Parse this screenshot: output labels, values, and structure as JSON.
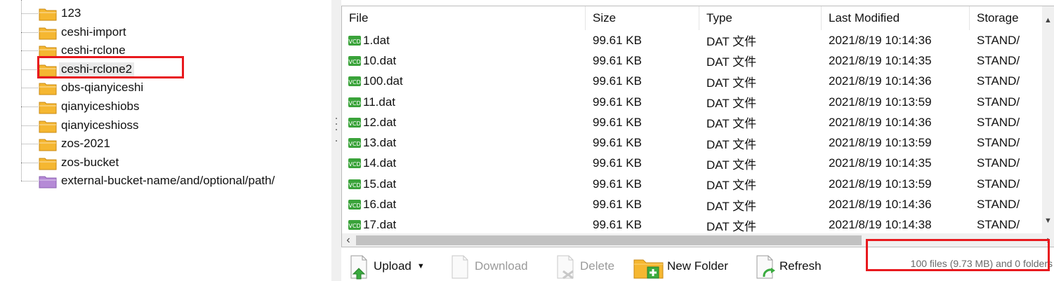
{
  "tree": {
    "items": [
      {
        "label": "123",
        "kind": "folder"
      },
      {
        "label": "ceshi-import",
        "kind": "folder"
      },
      {
        "label": "ceshi-rclone",
        "kind": "folder"
      },
      {
        "label": "ceshi-rclone2",
        "kind": "folder",
        "selected": true
      },
      {
        "label": "obs-qianyiceshi",
        "kind": "folder"
      },
      {
        "label": "qianyiceshiobs",
        "kind": "folder"
      },
      {
        "label": "qianyiceshioss",
        "kind": "folder"
      },
      {
        "label": "zos-2021",
        "kind": "folder"
      },
      {
        "label": "zos-bucket",
        "kind": "folder"
      },
      {
        "label": "external-bucket-name/and/optional/path/",
        "kind": "external"
      }
    ]
  },
  "list": {
    "columns": [
      "File",
      "Size",
      "Type",
      "Last Modified",
      "Storage"
    ],
    "rows": [
      {
        "file": "1.dat",
        "size": "99.61 KB",
        "type": "DAT 文件",
        "modified": "2021/8/19 10:14:36",
        "storage": "STAND/"
      },
      {
        "file": "10.dat",
        "size": "99.61 KB",
        "type": "DAT 文件",
        "modified": "2021/8/19 10:14:35",
        "storage": "STAND/"
      },
      {
        "file": "100.dat",
        "size": "99.61 KB",
        "type": "DAT 文件",
        "modified": "2021/8/19 10:14:36",
        "storage": "STAND/"
      },
      {
        "file": "11.dat",
        "size": "99.61 KB",
        "type": "DAT 文件",
        "modified": "2021/8/19 10:13:59",
        "storage": "STAND/"
      },
      {
        "file": "12.dat",
        "size": "99.61 KB",
        "type": "DAT 文件",
        "modified": "2021/8/19 10:14:36",
        "storage": "STAND/"
      },
      {
        "file": "13.dat",
        "size": "99.61 KB",
        "type": "DAT 文件",
        "modified": "2021/8/19 10:13:59",
        "storage": "STAND/"
      },
      {
        "file": "14.dat",
        "size": "99.61 KB",
        "type": "DAT 文件",
        "modified": "2021/8/19 10:14:35",
        "storage": "STAND/"
      },
      {
        "file": "15.dat",
        "size": "99.61 KB",
        "type": "DAT 文件",
        "modified": "2021/8/19 10:13:59",
        "storage": "STAND/"
      },
      {
        "file": "16.dat",
        "size": "99.61 KB",
        "type": "DAT 文件",
        "modified": "2021/8/19 10:14:36",
        "storage": "STAND/"
      },
      {
        "file": "17.dat",
        "size": "99.61 KB",
        "type": "DAT 文件",
        "modified": "2021/8/19 10:14:38",
        "storage": "STAND/"
      }
    ],
    "file_icon": "vcd-file-icon"
  },
  "toolbar": {
    "upload": "Upload",
    "download": "Download",
    "delete": "Delete",
    "new_folder": "New Folder",
    "refresh": "Refresh",
    "status": "100 files (9.73 MB) and 0 folders"
  },
  "colors": {
    "highlight": "#e8191e",
    "folder": "#f5b731",
    "external_folder": "#b58ad6",
    "file_icon": "#3aa33a"
  }
}
